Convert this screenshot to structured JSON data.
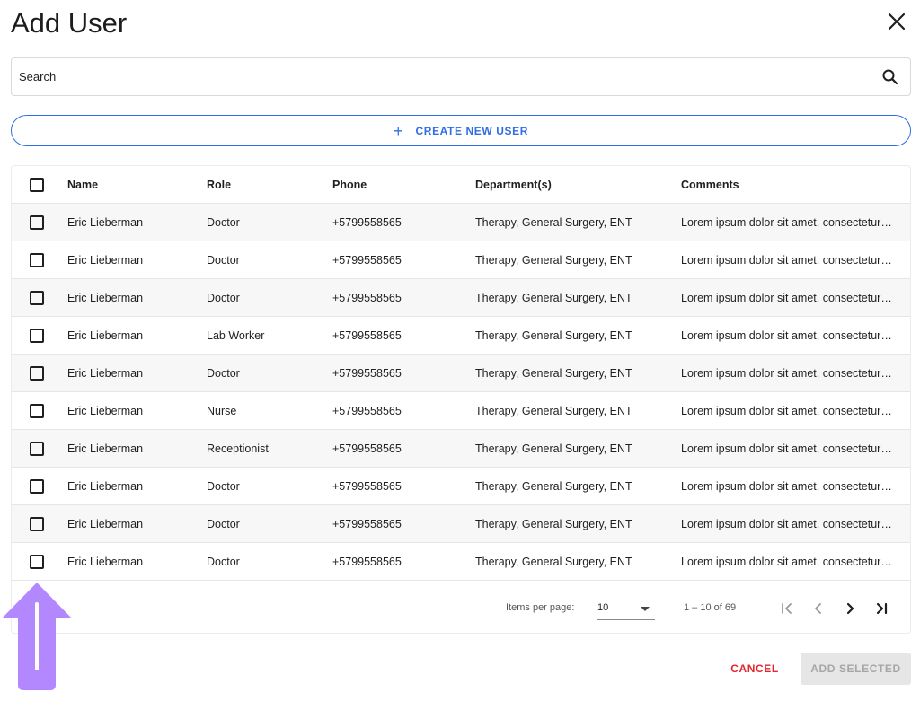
{
  "dialog": {
    "title": "Add User"
  },
  "search": {
    "placeholder": "Search",
    "value": ""
  },
  "create_button": {
    "label": "CREATE NEW USER"
  },
  "table": {
    "headers": {
      "name": "Name",
      "role": "Role",
      "phone": "Phone",
      "department": "Department(s)",
      "comments": "Comments"
    },
    "rows": [
      {
        "name": "Eric Lieberman",
        "role": "Doctor",
        "phone": "+5799558565",
        "department": "Therapy, General Surgery, ENT",
        "comments": "Lorem ipsum dolor sit amet, consectetur adipiscing elit"
      },
      {
        "name": "Eric Lieberman",
        "role": "Doctor",
        "phone": "+5799558565",
        "department": "Therapy, General Surgery, ENT",
        "comments": "Lorem ipsum dolor sit amet, consectetur adipiscing elit"
      },
      {
        "name": "Eric Lieberman",
        "role": "Doctor",
        "phone": "+5799558565",
        "department": "Therapy, General Surgery, ENT",
        "comments": "Lorem ipsum dolor sit amet, consectetur adipiscing elit"
      },
      {
        "name": "Eric Lieberman",
        "role": "Lab Worker",
        "phone": "+5799558565",
        "department": "Therapy, General Surgery, ENT",
        "comments": "Lorem ipsum dolor sit amet, consectetur adipiscing elit"
      },
      {
        "name": "Eric Lieberman",
        "role": "Doctor",
        "phone": "+5799558565",
        "department": "Therapy, General Surgery, ENT",
        "comments": "Lorem ipsum dolor sit amet, consectetur adipiscing elit"
      },
      {
        "name": "Eric Lieberman",
        "role": "Nurse",
        "phone": "+5799558565",
        "department": "Therapy, General Surgery, ENT",
        "comments": "Lorem ipsum dolor sit amet, consectetur adipiscing elit"
      },
      {
        "name": "Eric Lieberman",
        "role": "Receptionist",
        "phone": "+5799558565",
        "department": "Therapy, General Surgery, ENT",
        "comments": "Lorem ipsum dolor sit amet, consectetur adipiscing elit"
      },
      {
        "name": "Eric Lieberman",
        "role": "Doctor",
        "phone": "+5799558565",
        "department": "Therapy, General Surgery, ENT",
        "comments": "Lorem ipsum dolor sit amet, consectetur adipiscing elit"
      },
      {
        "name": "Eric Lieberman",
        "role": "Doctor",
        "phone": "+5799558565",
        "department": "Therapy, General Surgery, ENT",
        "comments": "Lorem ipsum dolor sit amet, consectetur adipiscing elit"
      },
      {
        "name": "Eric Lieberman",
        "role": "Doctor",
        "phone": "+5799558565",
        "department": "Therapy, General Surgery, ENT",
        "comments": "Lorem ipsum dolor sit amet, consectetur adipiscing elit"
      }
    ]
  },
  "pagination": {
    "items_per_page_label": "Items per page:",
    "items_per_page_value": "10",
    "range_label": "1 – 10 of 69"
  },
  "actions": {
    "cancel_label": "CANCEL",
    "add_selected_label": "ADD SELECTED"
  },
  "colors": {
    "accent": "#2f6ee3",
    "danger": "#e0272d",
    "annotation_arrow": "#b388ff"
  },
  "icons": {
    "close": "close-icon",
    "search": "search-icon",
    "plus": "plus-icon",
    "first_page": "first-page-icon",
    "prev_page": "chevron-left-icon",
    "next_page": "chevron-right-icon",
    "last_page": "last-page-icon",
    "annotation": "up-arrow-icon"
  }
}
